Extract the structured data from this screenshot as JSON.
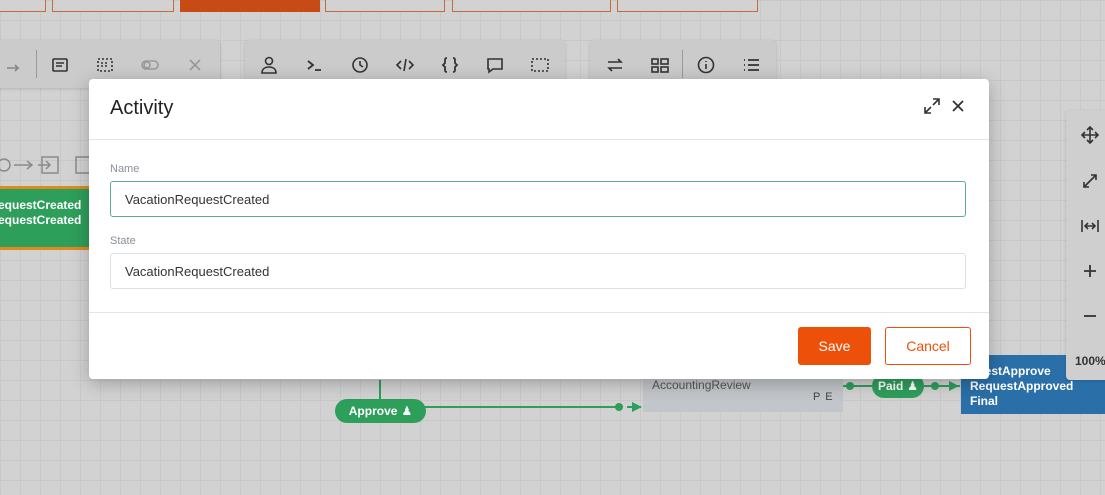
{
  "canvas": {
    "node_left": {
      "line1": "equestCreated",
      "line2": "equestCreated"
    },
    "approve_label": "Approve",
    "accounting_review": {
      "name": "AccountingReview",
      "badge": "P E"
    },
    "paid_label": "Paid",
    "node_right": {
      "line1": "questApprove",
      "line2": "RequestApproved",
      "line3": "Final"
    }
  },
  "zoom": "100%",
  "colors": {
    "accent": "#ed5008",
    "node_green": "#2e9e5b",
    "node_blue": "#2a6fa8"
  },
  "modal": {
    "title": "Activity",
    "name_label": "Name",
    "name_value": "VacationRequestCreated",
    "state_label": "State",
    "state_value": "VacationRequestCreated",
    "save_label": "Save",
    "cancel_label": "Cancel"
  }
}
